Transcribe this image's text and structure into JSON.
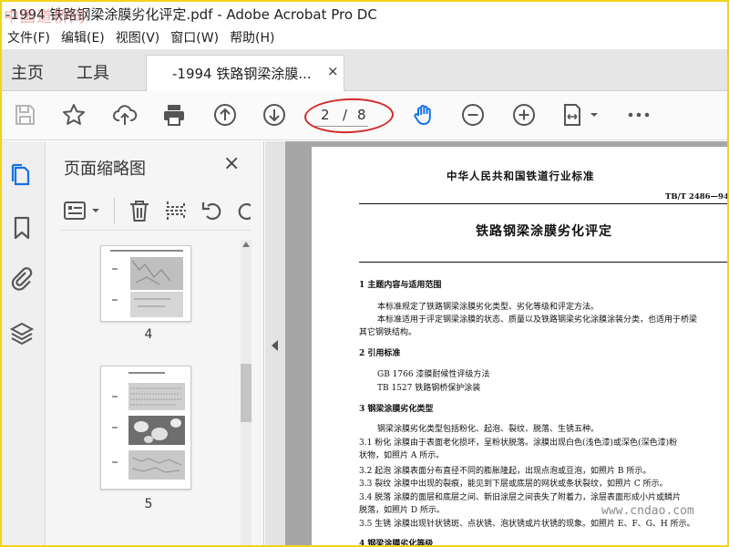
{
  "window": {
    "title": "-1994 铁路钢梁涂膜劣化评定.pdf - Adobe Acrobat Pro DC",
    "watermark": "中国道桥网"
  },
  "menu": [
    "文件(F)",
    "编辑(E)",
    "视图(V)",
    "窗口(W)",
    "帮助(H)"
  ],
  "tabs": {
    "home": "主页",
    "tools": "工具",
    "document": "-1994 铁路钢梁涂膜...",
    "close": "×"
  },
  "toolbar": {
    "page_current": "2",
    "page_separator": "/",
    "page_total": "8",
    "icons": [
      "save-icon",
      "bookmark-star-icon",
      "cloud-upload-icon",
      "print-icon",
      "page-up-icon",
      "page-down-icon",
      "hand-tool-icon",
      "zoom-out-icon",
      "zoom-in-icon",
      "fit-page-icon",
      "more-icon"
    ]
  },
  "sidebar": {
    "icons": [
      "page-thumbnails-icon",
      "bookmarks-icon",
      "attachments-icon",
      "layers-icon"
    ]
  },
  "thumbnail_panel": {
    "title": "页面缩略图",
    "close": "×",
    "pages": [
      {
        "label": "4"
      },
      {
        "label": "5"
      }
    ]
  },
  "document": {
    "org_header": "中华人民共和国铁道行业标准",
    "std_number": "TB/T 2486—94",
    "doc_title": "铁路钢梁涂膜劣化评定",
    "lines": [
      {
        "cls": "sec",
        "text": "1  主题内容与适用范围"
      },
      {
        "cls": "txt",
        "text": "本标准规定了铁路钢梁涂膜劣化类型、劣化等级和评定方法。"
      },
      {
        "cls": "txt",
        "text": "本标准适用于评定钢梁涂膜的状态、质量以及铁路钢梁劣化涂膜涂装分类，也适用于桥梁"
      },
      {
        "cls": "txt",
        "text": "其它钢铁结构。"
      },
      {
        "cls": "sec",
        "text": "2  引用标准"
      },
      {
        "cls": "txt",
        "text": "GB 1766   漆膜耐候性评级方法"
      },
      {
        "cls": "txt",
        "text": "TB 1527   铁路钢桥保护涂装"
      },
      {
        "cls": "sec",
        "text": "3  钢梁涂膜劣化类型"
      },
      {
        "cls": "txt",
        "text": "钢梁涂膜劣化类型包括粉化、起泡、裂纹、脱落、生锈五种。"
      },
      {
        "cls": "txt",
        "text": "3.1  粉化   涂膜由于表面老化损坏，呈粉状脱落。涂膜出现白色(浅色漆)或深色(深色漆)粉"
      },
      {
        "cls": "txt",
        "text": "状物，如照片 A 所示。"
      },
      {
        "cls": "txt",
        "text": "3.2  起泡   涂膜表面分布直径不同的膨胀隆起，出现点泡或豆泡，如照片 B 所示。"
      },
      {
        "cls": "txt",
        "text": "3.3  裂纹   涂膜中出现的裂痕，能见到下层或底层的网状或条状裂纹，如照片 C 所示。"
      },
      {
        "cls": "txt",
        "text": "3.4  脱落   涂膜的面层和底层之间、新旧涂层之间丧失了附着力，涂层表面形成小片或鳞片"
      },
      {
        "cls": "txt",
        "text": "脱落，如照片 D 所示。"
      },
      {
        "cls": "txt",
        "text": "3.5  生锈   涂膜出现针状锈斑、点状锈、泡状锈或片状锈的现象。如照片 E、F、G、H 所示。"
      },
      {
        "cls": "sec",
        "text": "4  钢梁涂膜劣化等级"
      }
    ],
    "watermark": "www.cndao.com"
  },
  "colors": {
    "accent_blue": "#1473e6",
    "annotation_red": "#d42a2a",
    "window_border": "#f2d21a"
  }
}
